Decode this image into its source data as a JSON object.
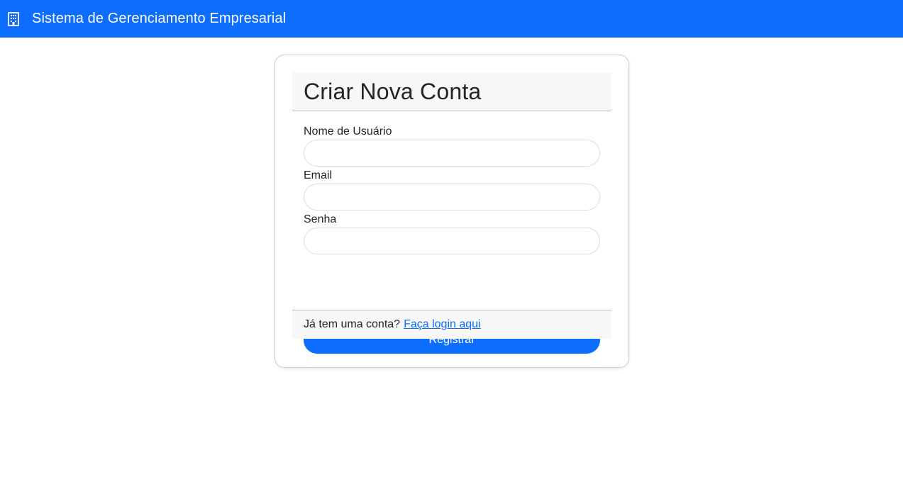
{
  "navbar": {
    "icon": "building-icon",
    "title": "Sistema de Gerenciamento Empresarial",
    "background_color": "#0d6efd"
  },
  "card": {
    "title": "Criar Nova Conta",
    "fields": {
      "username": {
        "label": "Nome de Usuário",
        "value": "",
        "placeholder": ""
      },
      "email": {
        "label": "Email",
        "value": "",
        "placeholder": ""
      },
      "password": {
        "label": "Senha",
        "value": "",
        "placeholder": ""
      }
    },
    "submit_label": "Registrar",
    "footer": {
      "text": "Já tem uma conta?",
      "link_label": "Faça login aqui"
    }
  },
  "colors": {
    "primary": "#0d6efd",
    "card_header_bg": "#f7f7f7",
    "text": "#212529"
  }
}
